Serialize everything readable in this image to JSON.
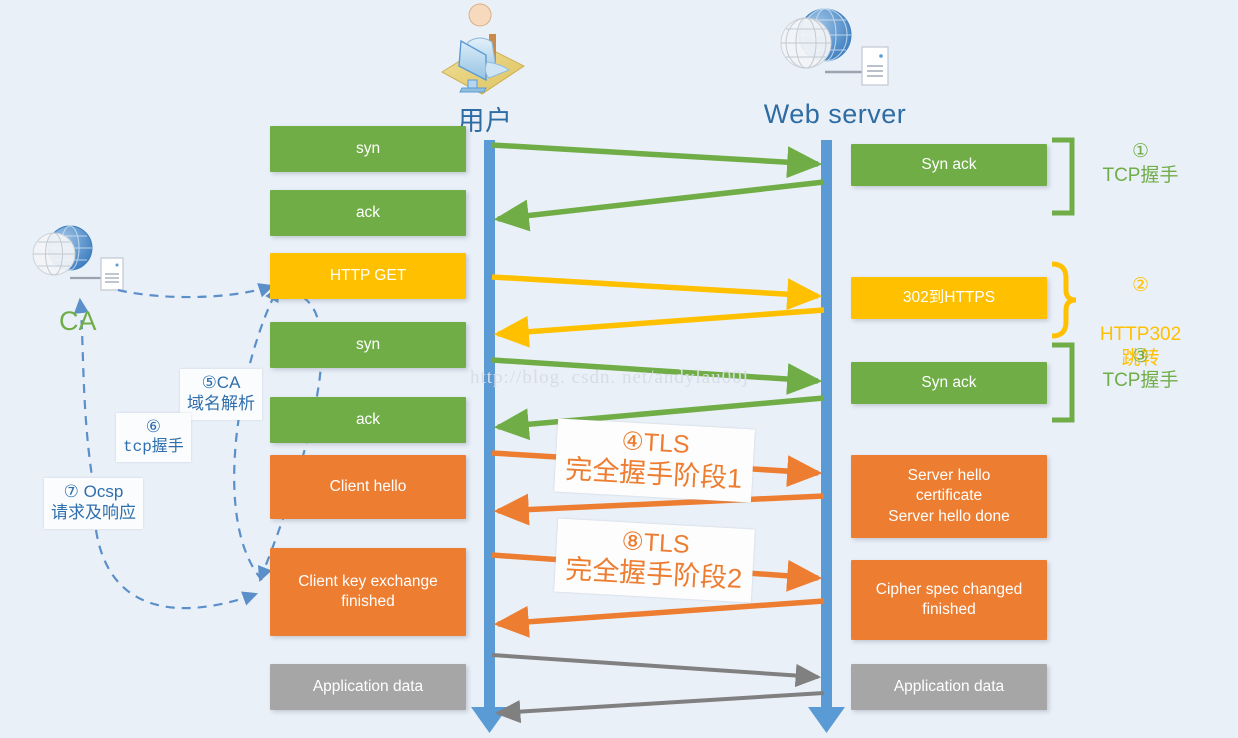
{
  "diagram": {
    "title_client": "用户",
    "title_server": "Web server",
    "watermark": "http://blog. csdn. net/andylau00j",
    "ca_label": "CA",
    "colors": {
      "background": "#eaf0f8",
      "green": "#70ad47",
      "yellow": "#ffc000",
      "orange": "#ed7d31",
      "gray": "#a6a6a6",
      "lifeline_blue": "#5b9bd5",
      "title_blue": "#2e6ca4",
      "dashed_blue": "#5b8fc9"
    }
  },
  "client_messages": [
    {
      "label": "syn",
      "color": "green"
    },
    {
      "label": "ack",
      "color": "green"
    },
    {
      "label": "HTTP GET",
      "color": "yellow"
    },
    {
      "label": "syn",
      "color": "green"
    },
    {
      "label": "ack",
      "color": "green"
    },
    {
      "label": "Client hello",
      "color": "orange"
    },
    {
      "label": "Client key exchange\nfinished",
      "color": "orange"
    },
    {
      "label": "Application data",
      "color": "gray"
    }
  ],
  "server_messages": [
    {
      "label": "Syn ack",
      "color": "green"
    },
    {
      "label": "302到HTTPS",
      "color": "yellow"
    },
    {
      "label": "Syn ack",
      "color": "green"
    },
    {
      "label": "Server hello\ncertificate\nServer hello done",
      "color": "orange"
    },
    {
      "label": "Cipher spec changed\nfinished",
      "color": "orange"
    },
    {
      "label": "Application data",
      "color": "gray"
    }
  ],
  "phases": [
    {
      "number": "①",
      "label": "TCP握手",
      "color": "green",
      "brace": "bracket"
    },
    {
      "number": "②",
      "label": "HTTP302\n跳转",
      "color": "yellow",
      "brace": "curly"
    },
    {
      "number": "③",
      "label": "TCP握手",
      "color": "green",
      "brace": "bracket"
    }
  ],
  "tls_callouts": [
    {
      "line1": "④TLS",
      "line2": "完全握手阶段1"
    },
    {
      "line1": "⑧TLS",
      "line2": "完全握手阶段2"
    }
  ],
  "ca_callouts": [
    {
      "line1": "⑤CA",
      "line2": "域名解析",
      "mono": false
    },
    {
      "line1": "⑥",
      "line2": "tcp握手",
      "mono": true
    },
    {
      "line1": "⑦ Ocsp",
      "line2": "请求及响应",
      "mono": false
    }
  ]
}
